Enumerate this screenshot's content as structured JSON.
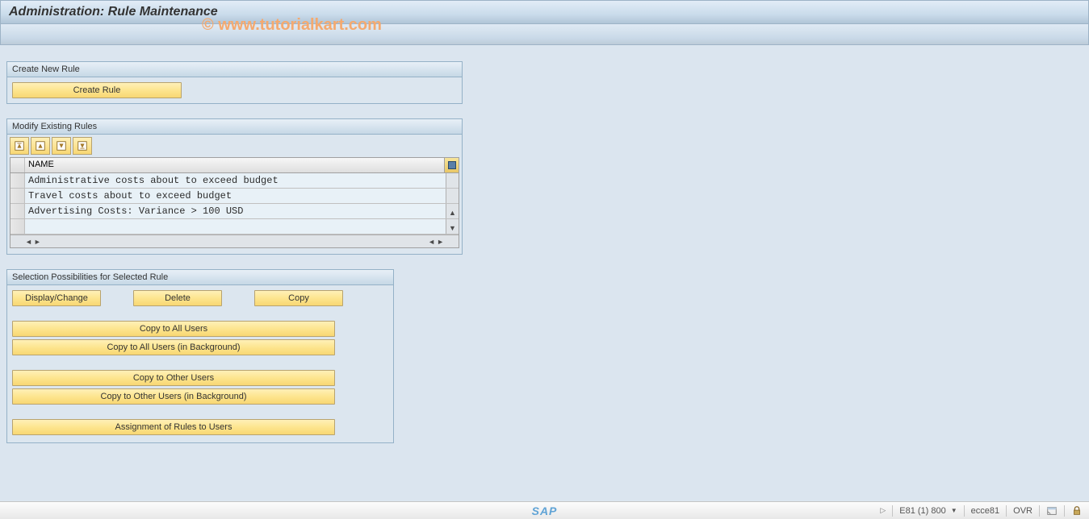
{
  "title": "Administration: Rule Maintenance",
  "watermark": "© www.tutorialkart.com",
  "panels": {
    "create": {
      "title": "Create New Rule",
      "button": "Create Rule"
    },
    "modify": {
      "title": "Modify Existing Rules",
      "column_header": "NAME",
      "rows": [
        "Administrative costs about to exceed budget",
        "Travel costs about to exceed budget",
        "Advertising Costs: Variance > 100 USD"
      ]
    },
    "selection": {
      "title": "Selection Possibilities for Selected Rule",
      "display_change": "Display/Change",
      "delete": "Delete",
      "copy": "Copy",
      "copy_all": "Copy to All Users",
      "copy_all_bg": "Copy to All Users (in Background)",
      "copy_other": "Copy to Other Users",
      "copy_other_bg": "Copy to Other Users (in Background)",
      "assign": "Assignment of Rules to Users"
    }
  },
  "status": {
    "system": "E81 (1) 800",
    "server": "ecce81",
    "mode": "OVR",
    "logo": "SAP"
  }
}
